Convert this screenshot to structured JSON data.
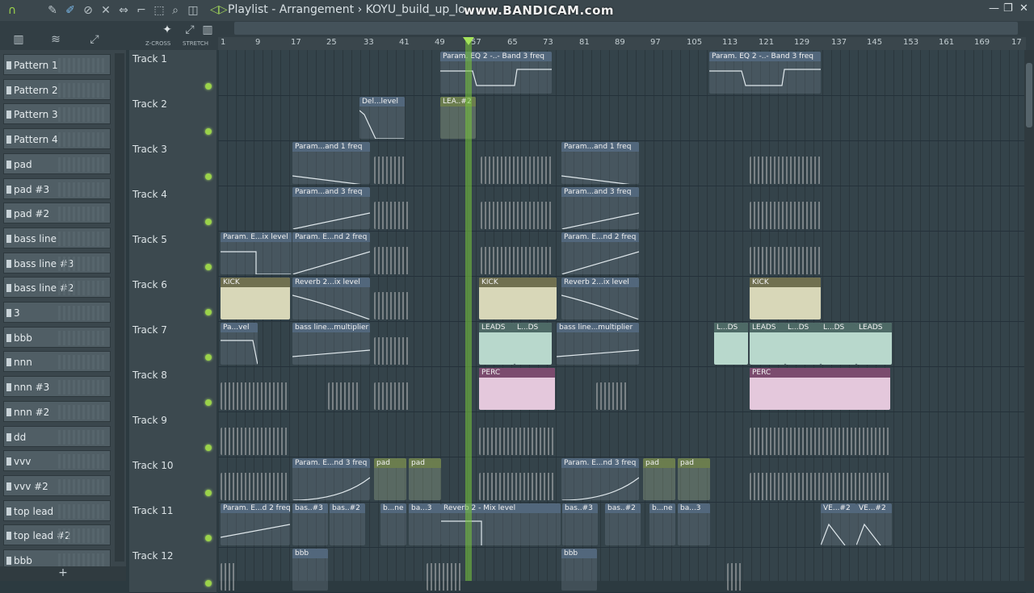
{
  "window": {
    "title": "Playlist - Arrangement",
    "project": "KOYU_build_up_lo",
    "watermark": "www.BANDICAM.com"
  },
  "toolbar": {
    "zcross_label": "Z-CROSS",
    "stretch_label": "STRETCH"
  },
  "ruler": [
    "1",
    "9",
    "17",
    "25",
    "33",
    "41",
    "49",
    "57",
    "65",
    "73",
    "81",
    "89",
    "97",
    "105",
    "113",
    "121",
    "129",
    "137",
    "145",
    "153",
    "161",
    "169",
    "17"
  ],
  "patterns": [
    "Pattern 1",
    "Pattern 2",
    "Pattern 3",
    "Pattern 4",
    "pad",
    "pad #3",
    "pad #2",
    "bass line",
    "bass line #3",
    "bass line #2",
    "3",
    "bbb",
    "nnn",
    "nnn #3",
    "nnn #2",
    "dd",
    "vvv",
    "vvv #2",
    "top lead",
    "top lead #2",
    "bbb"
  ],
  "browser": {
    "add_label": "+"
  },
  "tracks": [
    "Track 1",
    "Track 2",
    "Track 3",
    "Track 4",
    "Track 5",
    "Track 6",
    "Track 7",
    "Track 8",
    "Track 9",
    "Track 10",
    "Track 11",
    "Track 12"
  ],
  "clips": {
    "t1a": "Param. EQ 2 -..- Band 3 freq",
    "t1b": "Param. EQ 2 -..- Band 3 freq",
    "t2a": "Del...level",
    "t2b": "LEA..#2",
    "t3a": "Param...and 1 freq",
    "t3b": "Param...and 1 freq",
    "t4a": "Param...and 3 freq",
    "t4b": "Param...and 3 freq",
    "t5a": "Param. E...ix level",
    "t5b": "Param. E...nd 2 freq",
    "t5c": "Param. E...nd 2 freq",
    "t6a": "KICK",
    "t6b": "Reverb 2...ix level",
    "t6c": "KICK",
    "t6d": "Reverb 2...ix level",
    "t6e": "KICK",
    "t7a": "Pa...vel",
    "t7b": "bass line...multiplier",
    "t7c": "LEADS",
    "t7d": "L...DS",
    "t7e": "bass line...multiplier",
    "t7f": "L...DS",
    "t7g": "LEADS",
    "t7h": "L...DS",
    "t7i": "L...DS",
    "t7j": "LEADS",
    "t8a": "PERC",
    "t8b": "PERC",
    "t10a": "Param. E...nd 3 freq",
    "t10b": "pad",
    "t10c": "pad",
    "t10d": "Param. E...nd 3 freq",
    "t10e": "pad",
    "t10f": "pad",
    "t11a": "Param. E...d 2 freq",
    "t11b": "bas..#3",
    "t11c": "bas..#2",
    "t11d": "b...ne",
    "t11e": "ba...3",
    "t11f": "Reverb 2 - Mix level",
    "t11g": "bas..#3",
    "t11h": "bas..#2",
    "t11i": "b...ne",
    "t11j": "ba...3",
    "t11k": "VE...#2",
    "t11l": "VE...#2",
    "t12a": "bbb",
    "t12b": "bbb"
  },
  "colors": {
    "accent": "#9bd34a",
    "playhead": "#78c83c"
  }
}
